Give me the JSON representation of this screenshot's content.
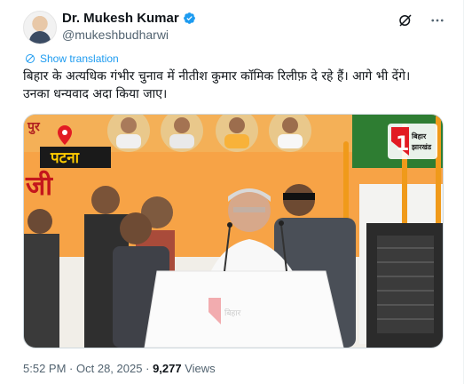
{
  "tweet": {
    "author_name": "Dr. Mukesh Kumar",
    "handle": "@mukeshbudharwi",
    "translate_label": "Show translation",
    "text_line1": "बिहार के अत्यधिक गंभीर चुनाव में नीतीश कुमार कॉमिक रिलीफ़ दे रहे हैं। आगे भी देंगे।",
    "text_line2": "उनका धन्यवाद अदा किया जाए।",
    "time": "5:52 PM",
    "date": "Oct 28, 2025",
    "views_count": "9,277",
    "views_label": "Views",
    "separator": "·"
  },
  "media": {
    "location_label": "पटना",
    "partial_word_top": "पुर",
    "partial_word_left": "जी",
    "channel_logo_text": "1",
    "channel_name_line1": "बिहार",
    "channel_name_line2": "झारखंड"
  },
  "icons": [
    "verified-badge-icon",
    "grok-icon",
    "more-icon",
    "translate-icon",
    "location-pin-icon"
  ],
  "colors": {
    "accent": "#1d9bf0",
    "text": "#0f1419",
    "muted": "#536471",
    "banner_orange": "#f39a3a",
    "channel_red": "#e21b23"
  }
}
